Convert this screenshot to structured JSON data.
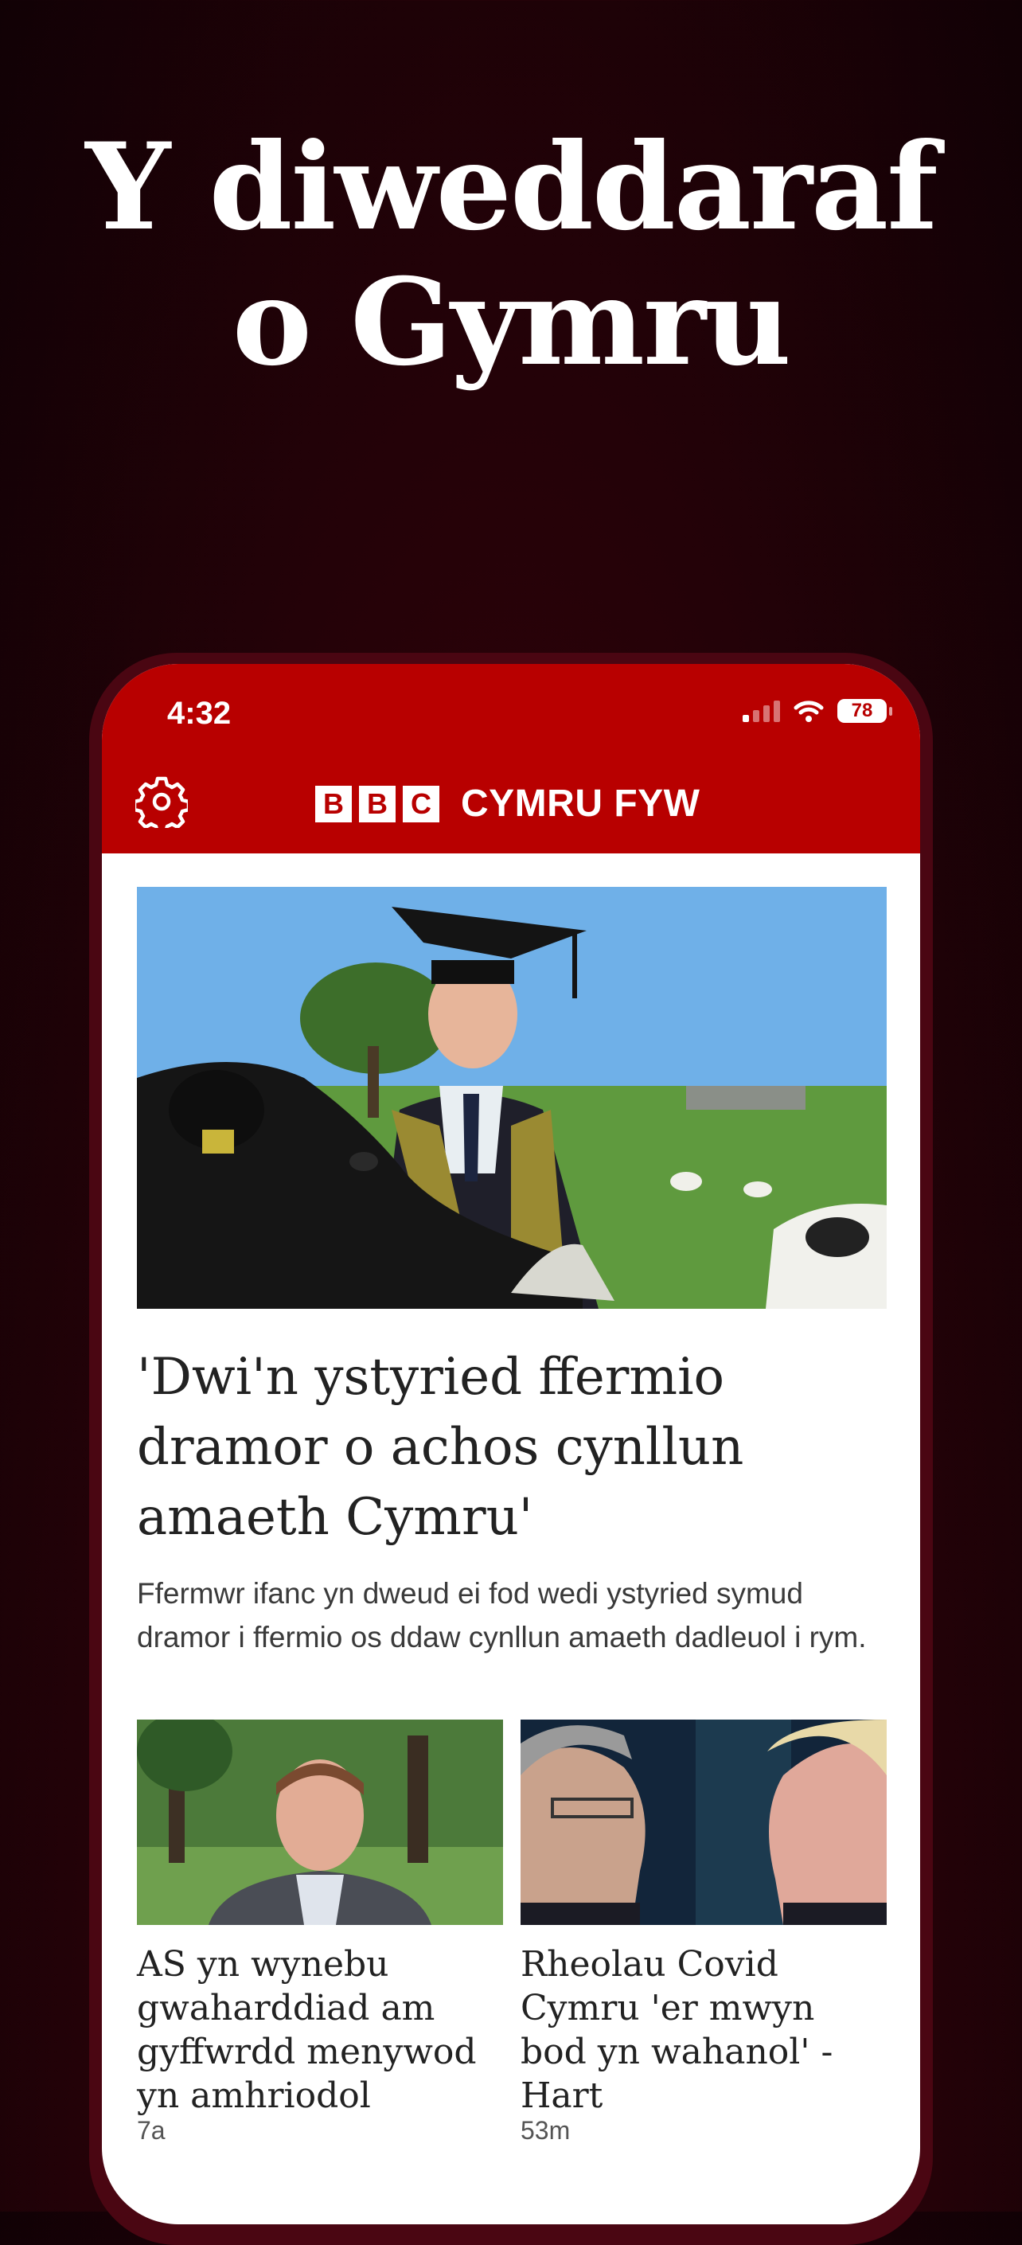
{
  "promo": {
    "headline_line1": "Y diweddaraf",
    "headline_line2": "o Gymru"
  },
  "status_bar": {
    "time": "4:32",
    "battery": "78"
  },
  "header": {
    "logo_letters": [
      "B",
      "B",
      "C"
    ],
    "title": "CYMRU FYW",
    "accent_color": "#b80000"
  },
  "top_story": {
    "title": "'Dwi'n ystyried ffermio dramor o achos cynllun amaeth Cymru'",
    "summary": "Ffermwr ifanc yn dweud ei fod wedi ystyried symud dramor i ffermio os ddaw cynllun amaeth dadleuol i rym."
  },
  "stories": [
    {
      "title": "AS yn wynebu gwaharddiad am gyffwrdd menywod yn amhriodol",
      "time": "7a"
    },
    {
      "title": "Rheolau Covid Cymru 'er mwyn bod yn wahanol' - Hart",
      "time": "53m"
    }
  ]
}
